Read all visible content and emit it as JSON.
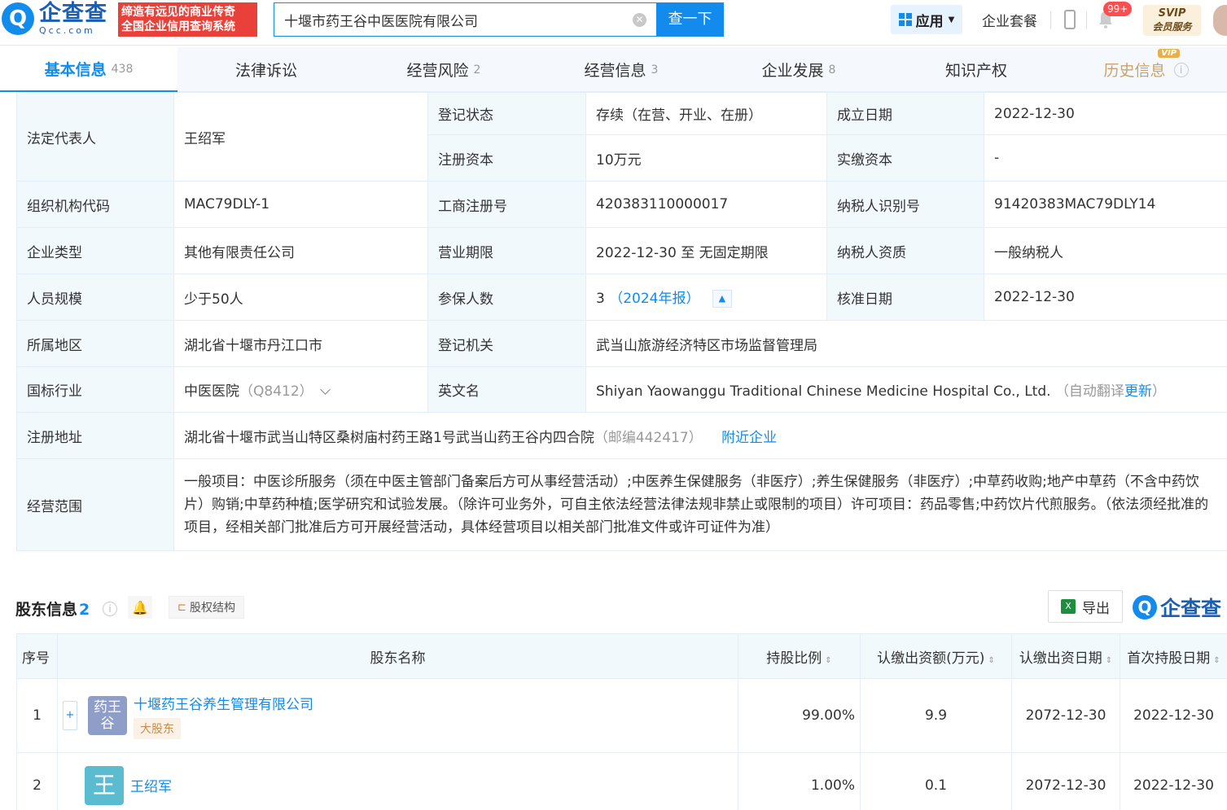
{
  "header": {
    "logo_cn": "企查查",
    "logo_en": "Qcc.com",
    "slogan_line1": "缔造有远见的商业传奇",
    "slogan_line2": "全国企业信用查询系统",
    "search_value": "十堰市药王谷中医医院有限公司",
    "search_button": "查一下",
    "app_label": "应用",
    "package_label": "企业套餐",
    "notif_badge": "99+",
    "svip_line1": "SVIP",
    "svip_line2": "会员服务"
  },
  "tabs": [
    {
      "label": "基本信息",
      "count": "438"
    },
    {
      "label": "法律诉讼",
      "count": ""
    },
    {
      "label": "经营风险",
      "count": "2"
    },
    {
      "label": "经营信息",
      "count": "3"
    },
    {
      "label": "企业发展",
      "count": "8"
    },
    {
      "label": "知识产权",
      "count": ""
    },
    {
      "label": "历史信息",
      "count": "",
      "tag": "VIP"
    }
  ],
  "info": {
    "legal_rep_label": "法定代表人",
    "legal_rep_value": "王绍军",
    "reg_status_label": "登记状态",
    "reg_status_value": "存续（在营、开业、在册）",
    "est_date_label": "成立日期",
    "est_date_value": "2022-12-30",
    "reg_capital_label": "注册资本",
    "reg_capital_value": "10万元",
    "paid_capital_label": "实缴资本",
    "paid_capital_value": "-",
    "org_code_label": "组织机构代码",
    "org_code_value": "MAC79DLY-1",
    "biz_reg_no_label": "工商注册号",
    "biz_reg_no_value": "420383110000017",
    "taxpayer_id_label": "纳税人识别号",
    "taxpayer_id_value": "91420383MAC79DLY14",
    "company_type_label": "企业类型",
    "company_type_value": "其他有限责任公司",
    "biz_term_label": "营业期限",
    "biz_term_value": "2022-12-30 至 无固定期限",
    "taxpayer_qual_label": "纳税人资质",
    "taxpayer_qual_value": "一般纳税人",
    "staff_label": "人员规模",
    "staff_value": "少于50人",
    "insured_label": "参保人数",
    "insured_value": "3",
    "insured_year": "（2024年报）",
    "approval_label": "核准日期",
    "approval_value": "2022-12-30",
    "region_label": "所属地区",
    "region_value": "湖北省十堰市丹江口市",
    "authority_label": "登记机关",
    "authority_value": "武当山旅游经济特区市场监督管理局",
    "industry_label": "国标行业",
    "industry_value": "中医医院",
    "industry_code": "（Q8412）",
    "en_name_label": "英文名",
    "en_name_value": "Shiyan Yaowanggu Traditional Chinese Medicine Hospital Co., Ltd.",
    "en_name_note_prefix": "（自动翻译",
    "en_name_note_link": "更新",
    "en_name_note_suffix": "）",
    "address_label": "注册地址",
    "address_value": "湖北省十堰市武当山特区桑树庙村药王路1号武当山药王谷内四合院",
    "postcode": "（邮编442417）",
    "nearby_link": "附近企业",
    "scope_label": "经营范围",
    "scope_value": "一般项目：中医诊所服务（须在中医主管部门备案后方可从事经营活动）;中医养生保健服务（非医疗）;养生保健服务（非医疗）;中草药收购;地产中草药（不含中药饮片）购销;中草药种植;医学研究和试验发展。（除许可业务外，可自主依法经营法律法规非禁止或限制的项目）许可项目：药品零售;中药饮片代煎服务。（依法须经批准的项目，经相关部门批准后方可开展经营活动，具体经营项目以相关部门批准文件或许可证件为准）"
  },
  "shareholders": {
    "title": "股东信息",
    "count": "2",
    "struct_label": "股权结构",
    "export_label": "导出",
    "watermark": "企查查",
    "columns": [
      "序号",
      "股东名称",
      "持股比例",
      "认缴出资额(万元)",
      "认缴出资日期",
      "首次持股日期"
    ],
    "rows": [
      {
        "index": "1",
        "logo_text": "药王谷",
        "name": "十堰药王谷养生管理有限公司",
        "tag": "大股东",
        "ratio": "99.00%",
        "amount": "9.9",
        "sub_date": "2072-12-30",
        "first_date": "2022-12-30"
      },
      {
        "index": "2",
        "logo_text": "王",
        "name": "王绍军",
        "tag": "",
        "ratio": "1.00%",
        "amount": "0.1",
        "sub_date": "2072-12-30",
        "first_date": "2022-12-30"
      }
    ]
  },
  "colors": {
    "brand": "#128bed",
    "slogan_bg": "#e9413a",
    "vip_gold": "#c9a468"
  }
}
